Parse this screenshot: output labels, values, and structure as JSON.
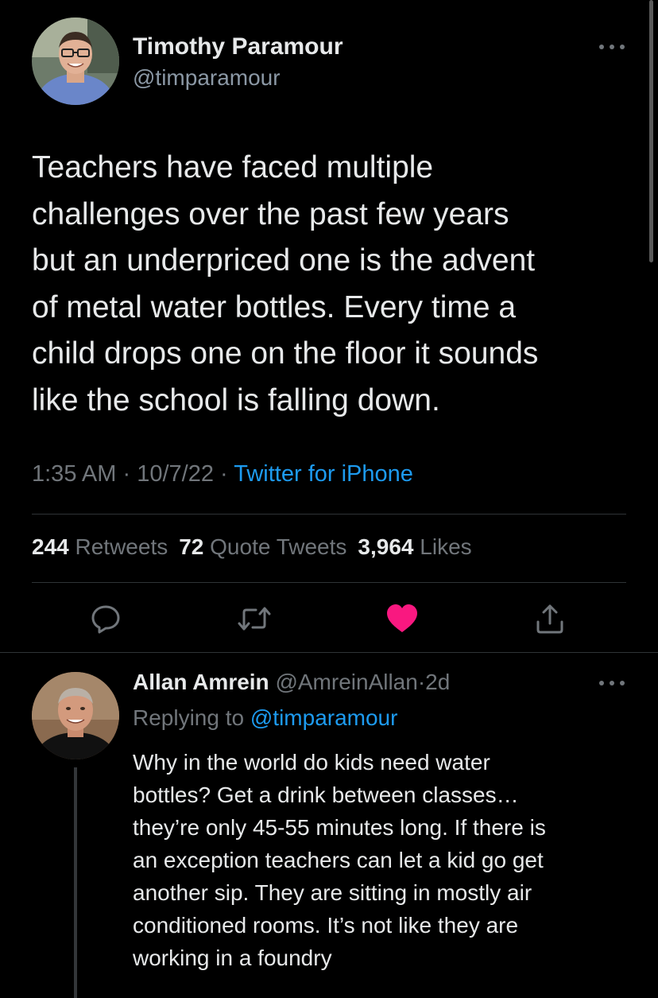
{
  "main_tweet": {
    "author_name": "Timothy Paramour",
    "author_handle": "@timparamour",
    "text": "Teachers have faced multiple\nchallenges over the past few years\nbut an underpriced one is the advent\nof metal water bottles. Every time a\nchild drops one on the floor it sounds\nlike the school is falling down.",
    "time": "1:35 AM",
    "date": "10/7/22",
    "separator": "·",
    "source": "Twitter for iPhone",
    "stats": {
      "retweets_count": "244",
      "retweets_label": "Retweets",
      "quote_count": "72",
      "quote_label": "Quote Tweets",
      "likes_count": "3,964",
      "likes_label": "Likes"
    },
    "actions": {
      "reply_icon": "reply-icon",
      "retweet_icon": "retweet-icon",
      "like_icon": "heart-icon",
      "share_icon": "share-icon",
      "liked": true
    }
  },
  "reply_tweet": {
    "author_name": "Allan Amrein",
    "author_handle": "@AmreinAllan",
    "separator": "·",
    "age": "2d",
    "replying_to_label": "Replying to",
    "replying_to_handle": "@timparamour",
    "text": "Why in the world do kids need water\nbottles?    Get a drink between classes…\nthey’re only 45-55 minutes long. If there is\nan exception teachers can let a kid go get\nanother sip. They are sitting in mostly air\nconditioned rooms. It’s not like they are\nworking in a foundry"
  },
  "colors": {
    "background": "#000000",
    "primary_text": "#e7e9ea",
    "secondary_text": "#71767b",
    "accent": "#1d9bf0",
    "like": "#f91880",
    "divider": "#2f3336"
  }
}
